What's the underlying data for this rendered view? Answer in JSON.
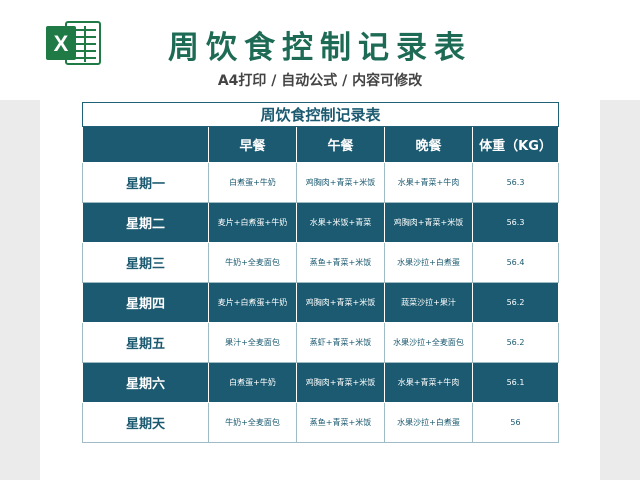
{
  "header": {
    "title": "周饮食控制记录表",
    "subtitle": "A4打印 / 自动公式 / 内容可修改",
    "logo_letter": "X"
  },
  "table": {
    "title": "周饮食控制记录表",
    "columns": [
      "",
      "早餐",
      "午餐",
      "晚餐",
      "体重（KG）"
    ],
    "rows": [
      {
        "day": "星期一",
        "breakfast": "白煮蛋+牛奶",
        "lunch": "鸡胸肉+青菜+米饭",
        "dinner": "水果+青菜+牛肉",
        "weight": "56.3"
      },
      {
        "day": "星期二",
        "breakfast": "麦片+白煮蛋+牛奶",
        "lunch": "水果+米饭+青菜",
        "dinner": "鸡胸肉+青菜+米饭",
        "weight": "56.3"
      },
      {
        "day": "星期三",
        "breakfast": "牛奶+全麦面包",
        "lunch": "蒸鱼+青菜+米饭",
        "dinner": "水果沙拉+白煮蛋",
        "weight": "56.4"
      },
      {
        "day": "星期四",
        "breakfast": "麦片+白煮蛋+牛奶",
        "lunch": "鸡胸肉+青菜+米饭",
        "dinner": "蔬菜沙拉+果汁",
        "weight": "56.2"
      },
      {
        "day": "星期五",
        "breakfast": "果汁+全麦面包",
        "lunch": "蒸虾+青菜+米饭",
        "dinner": "水果沙拉+全麦面包",
        "weight": "56.2"
      },
      {
        "day": "星期六",
        "breakfast": "白煮蛋+牛奶",
        "lunch": "鸡胸肉+青菜+米饭",
        "dinner": "水果+青菜+牛肉",
        "weight": "56.1"
      },
      {
        "day": "星期天",
        "breakfast": "牛奶+全麦面包",
        "lunch": "蒸鱼+青菜+米饭",
        "dinner": "水果沙拉+白煮蛋",
        "weight": "56"
      }
    ]
  },
  "colors": {
    "title_green": "#1e6b55",
    "table_teal": "#1b5a70",
    "excel_green": "#1f7a45"
  },
  "icons": {
    "logo": "excel-logo-icon"
  }
}
